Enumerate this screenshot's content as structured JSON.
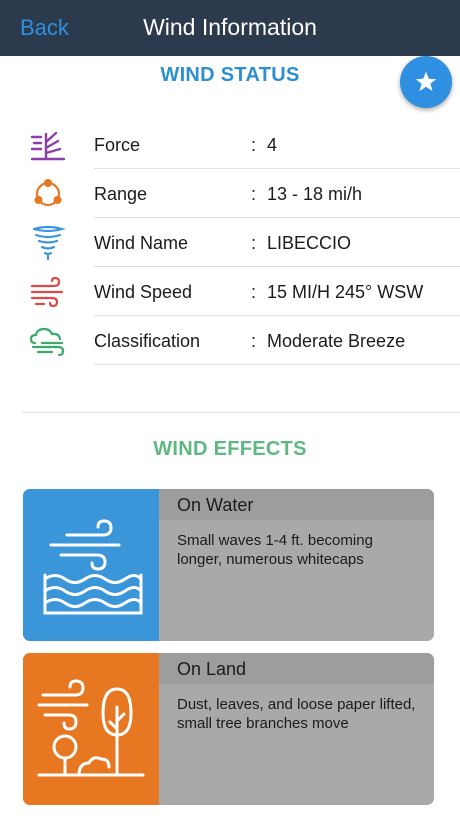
{
  "nav": {
    "back_label": "Back",
    "title": "Wind Information"
  },
  "wind_status": {
    "title": "WIND STATUS",
    "rows": [
      {
        "label": "Force",
        "value": "4",
        "icon": "force-icon",
        "color": "#8b3fa8"
      },
      {
        "label": "Range",
        "value": "13 - 18  mi/h",
        "icon": "range-icon",
        "color": "#e87722"
      },
      {
        "label": "Wind Name",
        "value": "LIBECCIO",
        "icon": "tornado-icon",
        "color": "#3a96d8"
      },
      {
        "label": "Wind Speed",
        "value": "15 MI/H 245° WSW",
        "icon": "wind-speed-icon",
        "color": "#e04848"
      },
      {
        "label": "Classification",
        "value": "Moderate Breeze",
        "icon": "cloud-wind-icon",
        "color": "#3aaa6a"
      }
    ],
    "separator": ":"
  },
  "favorite": {
    "icon": "star-icon"
  },
  "wind_effects": {
    "title": "WIND EFFECTS",
    "cards": [
      {
        "title": "On Water",
        "description": "Small waves 1-4 ft. becoming longer, numerous whitecaps",
        "color": "#3a96d8",
        "icon": "water-waves-icon"
      },
      {
        "title": "On Land",
        "description": "Dust, leaves, and loose paper lifted, small tree branches move",
        "color": "#e87722",
        "icon": "land-trees-icon"
      }
    ]
  }
}
